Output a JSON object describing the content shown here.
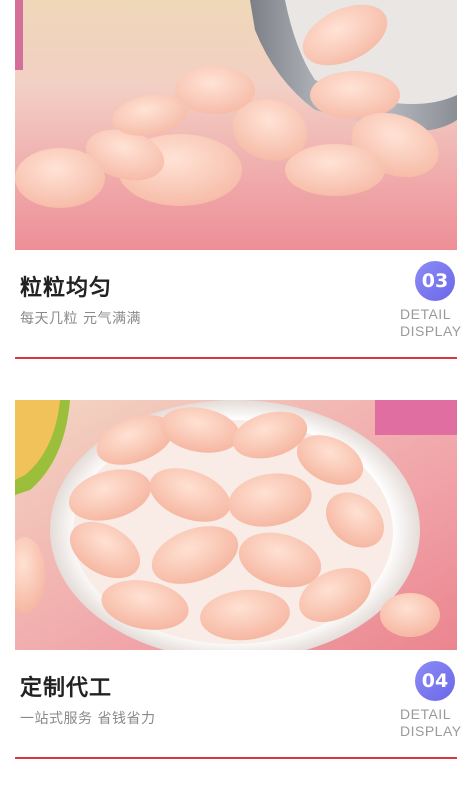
{
  "sections": [
    {
      "title": "粒粒均匀",
      "subtitle": "每天几粒 元气满满",
      "badge": "03",
      "detail_line1": "DETAIL",
      "detail_line2": "DISPLAY",
      "photo": "pink-vitamin-tablets-spilled-from-gray-bottle"
    },
    {
      "title": "定制代工",
      "subtitle": "一站式服务 省钱省力",
      "badge": "04",
      "detail_line1": "DETAIL",
      "detail_line2": "DISPLAY",
      "photo": "pink-vitamin-tablets-in-white-bowl"
    }
  ],
  "colors": {
    "accent_divider": "#d9363e",
    "badge_gradient_start": "#8d8cf6",
    "badge_gradient_end": "#6a67e8",
    "title_text": "#222222",
    "subtitle_text": "#8a8a8a"
  }
}
